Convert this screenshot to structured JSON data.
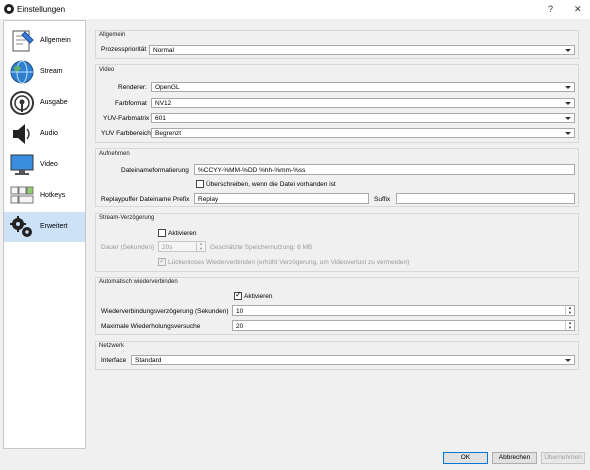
{
  "window": {
    "title": "Einstellungen",
    "help": "?",
    "close": "✕"
  },
  "sidebar": {
    "items": [
      {
        "label": "Allgemein"
      },
      {
        "label": "Stream"
      },
      {
        "label": "Ausgabe"
      },
      {
        "label": "Audio"
      },
      {
        "label": "Video"
      },
      {
        "label": "Hotkeys"
      },
      {
        "label": "Erweitert",
        "active": true
      }
    ]
  },
  "general": {
    "title": "Allgemein",
    "priority_label": "Prozesspriorität",
    "priority_value": "Normal"
  },
  "video": {
    "title": "Video",
    "renderer_label": "Renderer:",
    "renderer_value": "OpenGL",
    "format_label": "Farbformat",
    "format_value": "NV12",
    "matrix_label": "YUV-Farbmatrix",
    "matrix_value": "601",
    "range_label": "YUV Farbbereich",
    "range_value": "Begrenzt"
  },
  "recording": {
    "title": "Aufnehmen",
    "filename_label": "Dateinameformatierung",
    "filename_value": "%CCYY-%MM-%DD %hh-%mm-%ss",
    "overwrite_label": "Überschreiben, wenn die Datei vorhanden ist",
    "replay_prefix_label": "Replaypuffer Dateiname Prefix",
    "replay_prefix_value": "Replay",
    "suffix_label": "Suffix",
    "suffix_value": ""
  },
  "stream_delay": {
    "title": "Stream-Verzögerung",
    "enable_label": "Aktivieren",
    "duration_label": "Dauer (Sekunden)",
    "duration_value": "20s",
    "memory_label": "Geschätzte Speichernutzung: 6 MB",
    "reconnect_label": "Lückenloses Wiederverbinden (erhöht Verzögerung, um Videoverlust zu vermeiden)"
  },
  "auto_reconnect": {
    "title": "Automatisch wiederverbinden",
    "enable_label": "Aktivieren",
    "delay_label": "Wiederverbindungsverzögerung (Sekunden)",
    "delay_value": "10",
    "retries_label": "Maximale Wiederholungsversuche",
    "retries_value": "20"
  },
  "network": {
    "title": "Netzwerk",
    "interface_label": "Interface",
    "interface_value": "Standard"
  },
  "buttons": {
    "ok": "OK",
    "cancel": "Abbrechen",
    "apply": "Übernehmen"
  },
  "colors": {
    "accent": "#0078d7",
    "sidebar_selected": "#cde2f7"
  }
}
